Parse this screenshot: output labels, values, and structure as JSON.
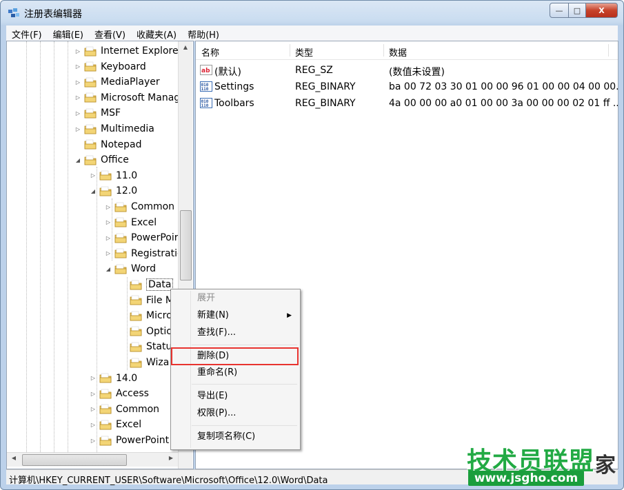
{
  "window": {
    "title": "注册表编辑器",
    "buttons": {
      "minimize": "—",
      "maximize": "□",
      "close": "X"
    }
  },
  "menubar": [
    "文件(F)",
    "编辑(E)",
    "查看(V)",
    "收藏夹(A)",
    "帮助(H)"
  ],
  "tree": [
    {
      "label": "Internet Explorer",
      "level": 0,
      "expander": "▷"
    },
    {
      "label": "Keyboard",
      "level": 0,
      "expander": "▷"
    },
    {
      "label": "MediaPlayer",
      "level": 0,
      "expander": "▷"
    },
    {
      "label": "Microsoft Manag",
      "level": 0,
      "expander": "▷"
    },
    {
      "label": "MSF",
      "level": 0,
      "expander": "▷"
    },
    {
      "label": "Multimedia",
      "level": 0,
      "expander": "▷"
    },
    {
      "label": "Notepad",
      "level": 0,
      "expander": ""
    },
    {
      "label": "Office",
      "level": 0,
      "expander": "◢"
    },
    {
      "label": "11.0",
      "level": 1,
      "expander": "▷"
    },
    {
      "label": "12.0",
      "level": 1,
      "expander": "◢"
    },
    {
      "label": "Common",
      "level": 2,
      "expander": "▷"
    },
    {
      "label": "Excel",
      "level": 2,
      "expander": "▷"
    },
    {
      "label": "PowerPoir",
      "level": 2,
      "expander": "▷"
    },
    {
      "label": "Registratic",
      "level": 2,
      "expander": "▷"
    },
    {
      "label": "Word",
      "level": 2,
      "expander": "◢"
    },
    {
      "label": "Data",
      "level": 3,
      "expander": "",
      "selected": true
    },
    {
      "label": "File M",
      "level": 3,
      "expander": ""
    },
    {
      "label": "Micro",
      "level": 3,
      "expander": ""
    },
    {
      "label": "Optio",
      "level": 3,
      "expander": ""
    },
    {
      "label": "Statu",
      "level": 3,
      "expander": ""
    },
    {
      "label": "Wiza",
      "level": 3,
      "expander": ""
    },
    {
      "label": "14.0",
      "level": 1,
      "expander": "▷"
    },
    {
      "label": "Access",
      "level": 1,
      "expander": "▷"
    },
    {
      "label": "Common",
      "level": 1,
      "expander": "▷"
    },
    {
      "label": "Excel",
      "level": 1,
      "expander": "▷"
    },
    {
      "label": "PowerPoint",
      "level": 1,
      "expander": "▷"
    }
  ],
  "values": {
    "headers": {
      "name": "名称",
      "type": "类型",
      "data": "数据"
    },
    "rows": [
      {
        "name": "(默认)",
        "type": "REG_SZ",
        "data": "(数值未设置)",
        "icon": "ab"
      },
      {
        "name": "Settings",
        "type": "REG_BINARY",
        "data": "ba 00 72 03 30 01 00 00 96 01 00 00 04 00 00...",
        "icon": "binary"
      },
      {
        "name": "Toolbars",
        "type": "REG_BINARY",
        "data": "4a 00 00 00 a0 01 00 00 3a 00 00 00 02 01 ff ...",
        "icon": "binary"
      }
    ]
  },
  "context_menu": {
    "expand": "展开",
    "new": "新建(N)",
    "find": "查找(F)...",
    "delete": "删除(D)",
    "rename": "重命名(R)",
    "export": "导出(E)",
    "permissions": "权限(P)...",
    "copy_key_name": "复制项名称(C)"
  },
  "statusbar": "计算机\\HKEY_CURRENT_USER\\Software\\Microsoft\\Office\\12.0\\Word\\Data",
  "watermark": {
    "title": "技术员联盟",
    "url": "www.jsgho.com",
    "suffix": "家"
  },
  "colors": {
    "highlight_border": "#e8332f",
    "folder": "#e8c25a",
    "watermark_green": "#1a9e3c"
  }
}
